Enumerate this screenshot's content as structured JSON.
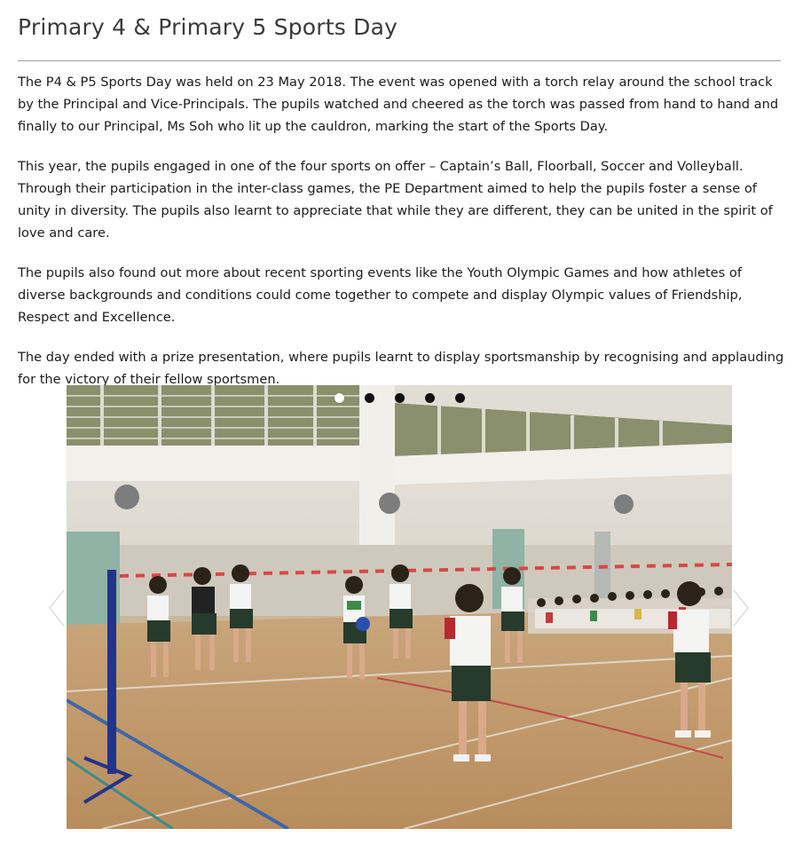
{
  "article": {
    "title": "Primary 4 & Primary 5 Sports Day",
    "paragraphs": [
      "The P4 & P5 Sports Day was held on 23 May 2018. The event was opened with a torch relay around the school track by the Principal and Vice-Principals. The pupils watched and cheered as the torch was passed from hand to hand and finally to our Principal, Ms Soh who lit up the cauldron, marking the start of the Sports Day.",
      "This year, the pupils engaged in one of the four sports on offer – Captain’s Ball, Floorball, Soccer and Volleyball. Through their participation in the inter-class games, the PE Department aimed to help the pupils foster a sense of unity in diversity. The pupils also learnt to appreciate that while they are different, they can be united in the spirit of love and care.",
      "The pupils also found out more about recent sporting events like the Youth Olympic Games and how athletes of diverse backgrounds and conditions could come together to compete and display Olympic values of Friendship, Respect and Excellence.",
      "The day ended with a prize presentation, where pupils learnt to display sportsmanship by recognising and applauding for the victory of their fellow sportsmen."
    ]
  },
  "carousel": {
    "slide_count": 5,
    "active_index": 0,
    "prev_icon": "chevron-left-icon",
    "next_icon": "chevron-right-icon",
    "photo_subject": "photo",
    "colors": {
      "active_dot": "#ffffff",
      "inactive_dot": "#111111"
    }
  }
}
